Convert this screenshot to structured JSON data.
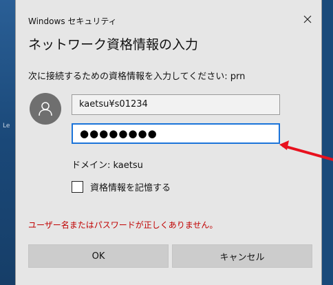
{
  "background": {
    "left_fragment_text": "Le"
  },
  "dialog": {
    "app_title": "Windows セキュリティ",
    "heading": "ネットワーク資格情報の入力",
    "prompt": "次に接続するための資格情報を入力してください: prn",
    "username_value": "kaetsu¥s01234",
    "password_mask": "●●●●●●●●",
    "password_length": 8,
    "domain_text": "ドメイン: kaetsu",
    "remember_label": "資格情報を記憶する",
    "remember_checked": false,
    "error_message": "ユーザー名またはパスワードが正しくありません。",
    "ok_label": "OK",
    "cancel_label": "キャンセル",
    "close_icon": "close-icon",
    "avatar_icon": "user-icon"
  },
  "colors": {
    "dialog_bg": "#e6e6e6",
    "focus_border": "#1a73d9",
    "error_text": "#c00000",
    "annotation_arrow": "#e8111e",
    "desktop_bg": "#1d4f82"
  }
}
